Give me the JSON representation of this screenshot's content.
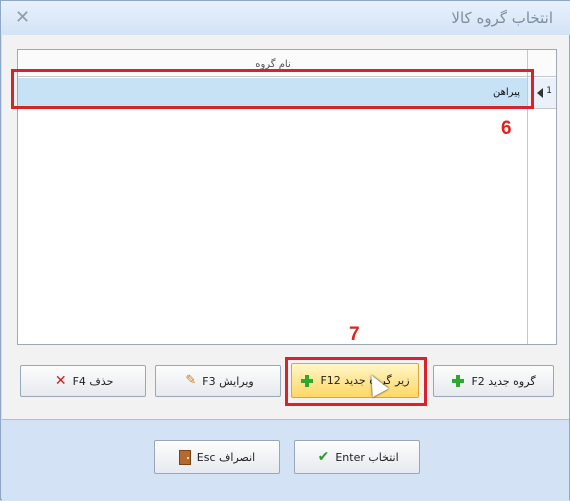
{
  "window": {
    "title": "انتخاب گروه کالا",
    "close_symbol": "✕"
  },
  "grid": {
    "column_header": "نام گروه",
    "rows": [
      {
        "number": "1",
        "name": "پیراهن"
      }
    ]
  },
  "markers": {
    "row_marker": "6",
    "button_marker": "7"
  },
  "buttons": {
    "new_group": "گروه جدید F2",
    "new_subgroup": "زیر گروه جدید F12",
    "edit": "ویرایش F3",
    "delete": "حذف F4",
    "select": "انتخاب Enter",
    "cancel": "انصراف Esc"
  },
  "icons": {
    "new_group": "plus-icon",
    "new_subgroup": "plus-icon",
    "edit": "pencil-icon",
    "delete": "x-icon",
    "select": "check-icon",
    "cancel": "door-icon"
  },
  "colors": {
    "selected_row": "#c6e2f4",
    "highlight_red": "#d9232a",
    "hot_button": "#ffd764"
  }
}
